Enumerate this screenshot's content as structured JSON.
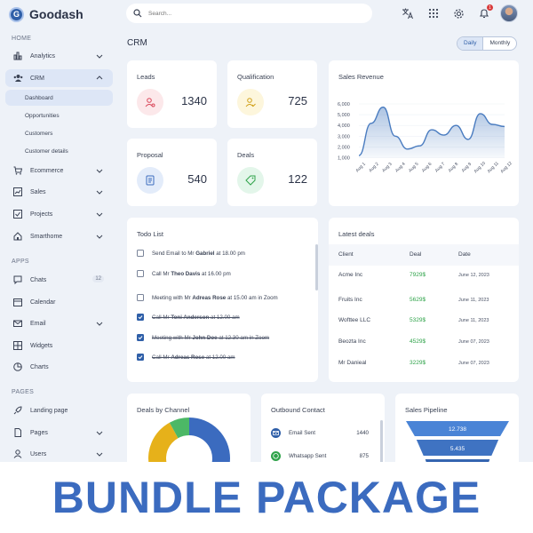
{
  "app": {
    "name": "Goodash",
    "logo_letter": "G"
  },
  "search": {
    "placeholder": "Search..."
  },
  "topbar": {
    "notification_count": "1"
  },
  "sidebar": {
    "home_title": "HOME",
    "apps_title": "APPS",
    "pages_title": "PAGES",
    "items": [
      {
        "label": "Analytics",
        "icon": "bar-chart-icon"
      },
      {
        "label": "CRM",
        "icon": "users-icon"
      },
      {
        "label": "Ecommerce",
        "icon": "cart-icon"
      },
      {
        "label": "Sales",
        "icon": "trend-icon"
      },
      {
        "label": "Projects",
        "icon": "checkbox-icon"
      },
      {
        "label": "Smarthome",
        "icon": "home-icon"
      },
      {
        "label": "Chats",
        "icon": "chat-icon",
        "badge": "12"
      },
      {
        "label": "Calendar",
        "icon": "calendar-icon"
      },
      {
        "label": "Email",
        "icon": "mail-icon"
      },
      {
        "label": "Widgets",
        "icon": "widgets-icon"
      },
      {
        "label": "Charts",
        "icon": "pie-icon"
      },
      {
        "label": "Landing page",
        "icon": "rocket-icon"
      },
      {
        "label": "Pages",
        "icon": "page-icon"
      },
      {
        "label": "Users",
        "icon": "user-icon"
      }
    ],
    "crm_sub": [
      "Dashboard",
      "Opportunities",
      "Customers",
      "Customer details"
    ]
  },
  "page": {
    "title": "CRM",
    "toggle": [
      "Daily",
      "Monthly"
    ]
  },
  "stats": [
    {
      "label": "Leads",
      "value": "1340",
      "color": "#fce8ea",
      "icon_color": "#d9475a"
    },
    {
      "label": "Qualification",
      "value": "725",
      "color": "#fdf6dc",
      "icon_color": "#d1a11c"
    },
    {
      "label": "Proposal",
      "value": "540",
      "color": "#e3ecfa",
      "icon_color": "#3b6bbf"
    },
    {
      "label": "Deals",
      "value": "122",
      "color": "#e3f6ea",
      "icon_color": "#2fa34a"
    }
  ],
  "sales_revenue": {
    "title": "Sales Revenue",
    "chart_data": {
      "type": "area",
      "x": [
        "Aug 1",
        "Aug 2",
        "Aug 3",
        "Aug 4",
        "Aug 5",
        "Aug 6",
        "Aug 7",
        "Aug 8",
        "Aug 9",
        "Aug 10",
        "Aug 11",
        "Aug 12"
      ],
      "y": [
        1200,
        4200,
        5700,
        3000,
        1800,
        2100,
        3600,
        3100,
        4000,
        2700,
        5100,
        4100,
        3900
      ],
      "yticks": [
        "6,000",
        "5,000",
        "4,000",
        "3,000",
        "2,000",
        "1,000"
      ],
      "ylim": [
        1000,
        6000
      ],
      "color": "#4a7cc0"
    }
  },
  "todo": {
    "title": "Todo List",
    "items": [
      {
        "pre": "Send Email to Mr ",
        "bold": "Gabriel",
        "post": " at 18.00 pm",
        "done": false
      },
      {
        "pre": "Call Mr ",
        "bold": "Theo Davis",
        "post": " at 16.00 pm",
        "done": false
      },
      {
        "pre": "Meeting with Mr ",
        "bold": "Adreas Rose",
        "post": " at 15.00 am in Zoom",
        "done": false
      },
      {
        "pre": "Call Mr ",
        "bold": "Toni Anderson",
        "post": " at 12.00 am",
        "done": true
      },
      {
        "pre": "Meeting with Mr ",
        "bold": "John Doe",
        "post": " at 12.30 am in Zoom",
        "done": true
      },
      {
        "pre": "Call Mr ",
        "bold": "Adreas Rose",
        "post": " at 12.00 am",
        "done": true
      }
    ]
  },
  "latest_deals": {
    "title": "Latest deals",
    "headers": [
      "Client",
      "Deal",
      "Date"
    ],
    "rows": [
      [
        "Acme Inc",
        "7929$",
        "June 12, 2023"
      ],
      [
        "Fruits Inc",
        "5629$",
        "June 11, 2023"
      ],
      [
        "Wofttee LLC",
        "5329$",
        "June 11, 2023"
      ],
      [
        "Beozta Inc",
        "4529$",
        "June 07, 2023"
      ],
      [
        "Mr Danieal",
        "3229$",
        "June 07, 2023"
      ]
    ]
  },
  "deals_channel": {
    "title": "Deals by Channel",
    "chart_data": {
      "type": "pie",
      "values": [
        50,
        42,
        8
      ],
      "colors": [
        "#3b6bbf",
        "#e6b11a",
        "#4cb866"
      ]
    }
  },
  "outbound": {
    "title": "Outbound Contact",
    "rows": [
      {
        "label": "Email Sent",
        "value": "1440",
        "icon": "mail-icon",
        "color": "#2f5fa8"
      },
      {
        "label": "Whatsapp Sent",
        "value": "875",
        "icon": "whatsapp-icon",
        "color": "#2fa34a"
      }
    ]
  },
  "pipeline": {
    "title": "Sales Pipeline",
    "chart_data": {
      "type": "bar",
      "values": [
        12738,
        5435
      ],
      "labels": [
        "12.738",
        "5.435"
      ],
      "color": "#4a84d6"
    }
  },
  "banner": {
    "text": "BUNDLE PACKAGE"
  }
}
